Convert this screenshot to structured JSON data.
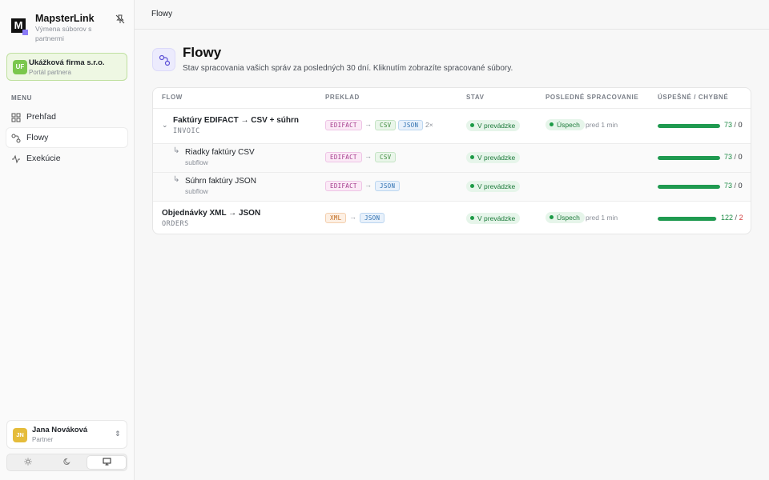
{
  "app": {
    "name": "MapsterLink",
    "tagline": "Výmena súborov s partnermi",
    "logo_letter": "M"
  },
  "organization": {
    "initials": "UF",
    "name": "Ukážková firma s.r.o.",
    "portal": "Portál partnera"
  },
  "menu": {
    "label": "MENU",
    "items": [
      {
        "label": "Prehľad",
        "icon": "grid-icon",
        "active": false
      },
      {
        "label": "Flowy",
        "icon": "flow-icon",
        "active": true
      },
      {
        "label": "Exekúcie",
        "icon": "activity-icon",
        "active": false
      }
    ]
  },
  "user": {
    "initials": "JN",
    "name": "Jana Nováková",
    "role": "Partner"
  },
  "theme": {
    "options": [
      "sun-icon",
      "moon-icon",
      "monitor-icon"
    ],
    "active": "monitor-icon"
  },
  "breadcrumb": "Flowy",
  "page": {
    "title": "Flowy",
    "subtitle": "Stav spracovania vašich správ za posledných 30 dní. Kliknutím zobrazíte spracované súbory."
  },
  "table": {
    "headers": {
      "flow": "FLOW",
      "translation": "PREKLAD",
      "status": "STAV",
      "last": "POSLEDNÉ SPRACOVANIE",
      "results": "ÚSPEŠNÉ / CHYBNÉ"
    },
    "rows": [
      {
        "name": "Faktúry EDIFACT → CSV + súhrn",
        "code": "INVOIC",
        "from": "EDIFACT",
        "to": [
          "CSV",
          "JSON"
        ],
        "multiplier": "2×",
        "status": "V prevádzke",
        "last_status": "Úspech",
        "last_time": "pred 1 min",
        "ok": "73",
        "err": "0",
        "ok_fraction": 1.0
      },
      {
        "name": "Riadky faktúry CSV",
        "tag": "subflow",
        "from": "EDIFACT",
        "to": [
          "CSV"
        ],
        "status": "V prevádzke",
        "ok": "73",
        "err": "0",
        "ok_fraction": 1.0
      },
      {
        "name": "Súhrn faktúry JSON",
        "tag": "subflow",
        "from": "EDIFACT",
        "to": [
          "JSON"
        ],
        "status": "V prevádzke",
        "ok": "73",
        "err": "0",
        "ok_fraction": 1.0
      },
      {
        "name": "Objednávky XML → JSON",
        "code": "ORDERS",
        "from": "XML",
        "to": [
          "JSON"
        ],
        "status": "V prevádzke",
        "last_status": "Úspech",
        "last_time": "pred 1 min",
        "ok": "122",
        "err": "2",
        "ok_fraction": 0.984
      }
    ]
  },
  "colors": {
    "accent": "#8b7cf6",
    "success": "#1f9a50",
    "error": "#d23b3b"
  }
}
